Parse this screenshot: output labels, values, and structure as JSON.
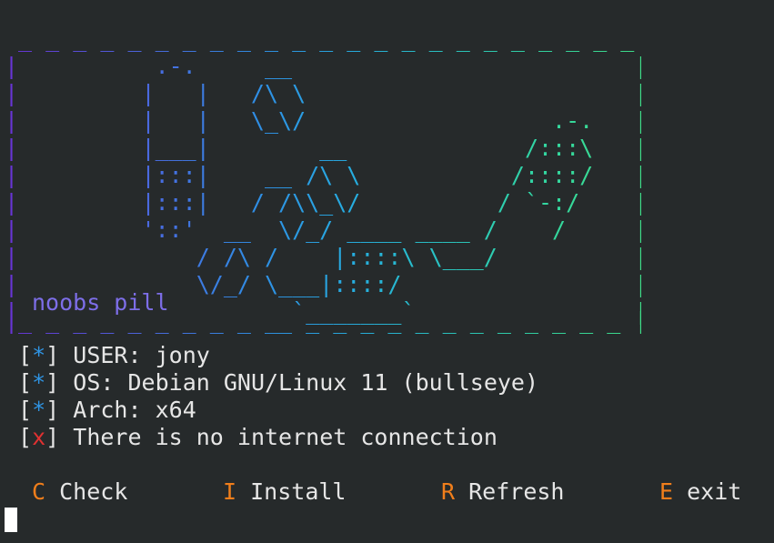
{
  "banner": {
    "lines": [
      " _ _ _ _ _ _ _ _ _ _ _ _ _ _ _ _ _ _ _ _ _ _ _ ",
      "|          .-.     __                         |",
      "|         |   |   /\\ \\                        |",
      "|         |   |   \\_\\/                  .-.   |",
      "|         |___|        __             /:::\\   |",
      "|         |:::|    __ /\\ \\           /::::/   |",
      "|         |:::|   / /\\\\_\\/          / `-:/    |",
      "|         '::'  __  \\/_/ ____ ____ /    /     |",
      "|             / /\\ /    |::::\\ \\___/          |",
      "|             \\/_/ \\___|::::/                 |",
      "|                    `_______`                |",
      "|_ _ _ _ _ _ _ _ _ __ _ _ _ _ _ _ _ _ _ _ _ _ |"
    ],
    "label": "noobs pill"
  },
  "info": [
    {
      "marker": "*",
      "text": "USER: jony",
      "status": "ok"
    },
    {
      "marker": "*",
      "text": "OS: Debian GNU/Linux 11 (bullseye)",
      "status": "ok"
    },
    {
      "marker": "*",
      "text": "Arch: x64",
      "status": "ok"
    },
    {
      "marker": "x",
      "text": "There is no internet connection",
      "status": "error"
    }
  ],
  "menu": [
    {
      "key": "C",
      "label": "Check"
    },
    {
      "key": "I",
      "label": "Install"
    },
    {
      "key": "R",
      "label": "Refresh"
    },
    {
      "key": "E",
      "label": "exit"
    }
  ],
  "colors": {
    "background": "#262a2b",
    "text": "#e6e6e6",
    "marker_ok": "#2f95e5",
    "marker_error": "#e03131",
    "menu_key": "#f07e1b",
    "label": "#7d6ee8"
  }
}
